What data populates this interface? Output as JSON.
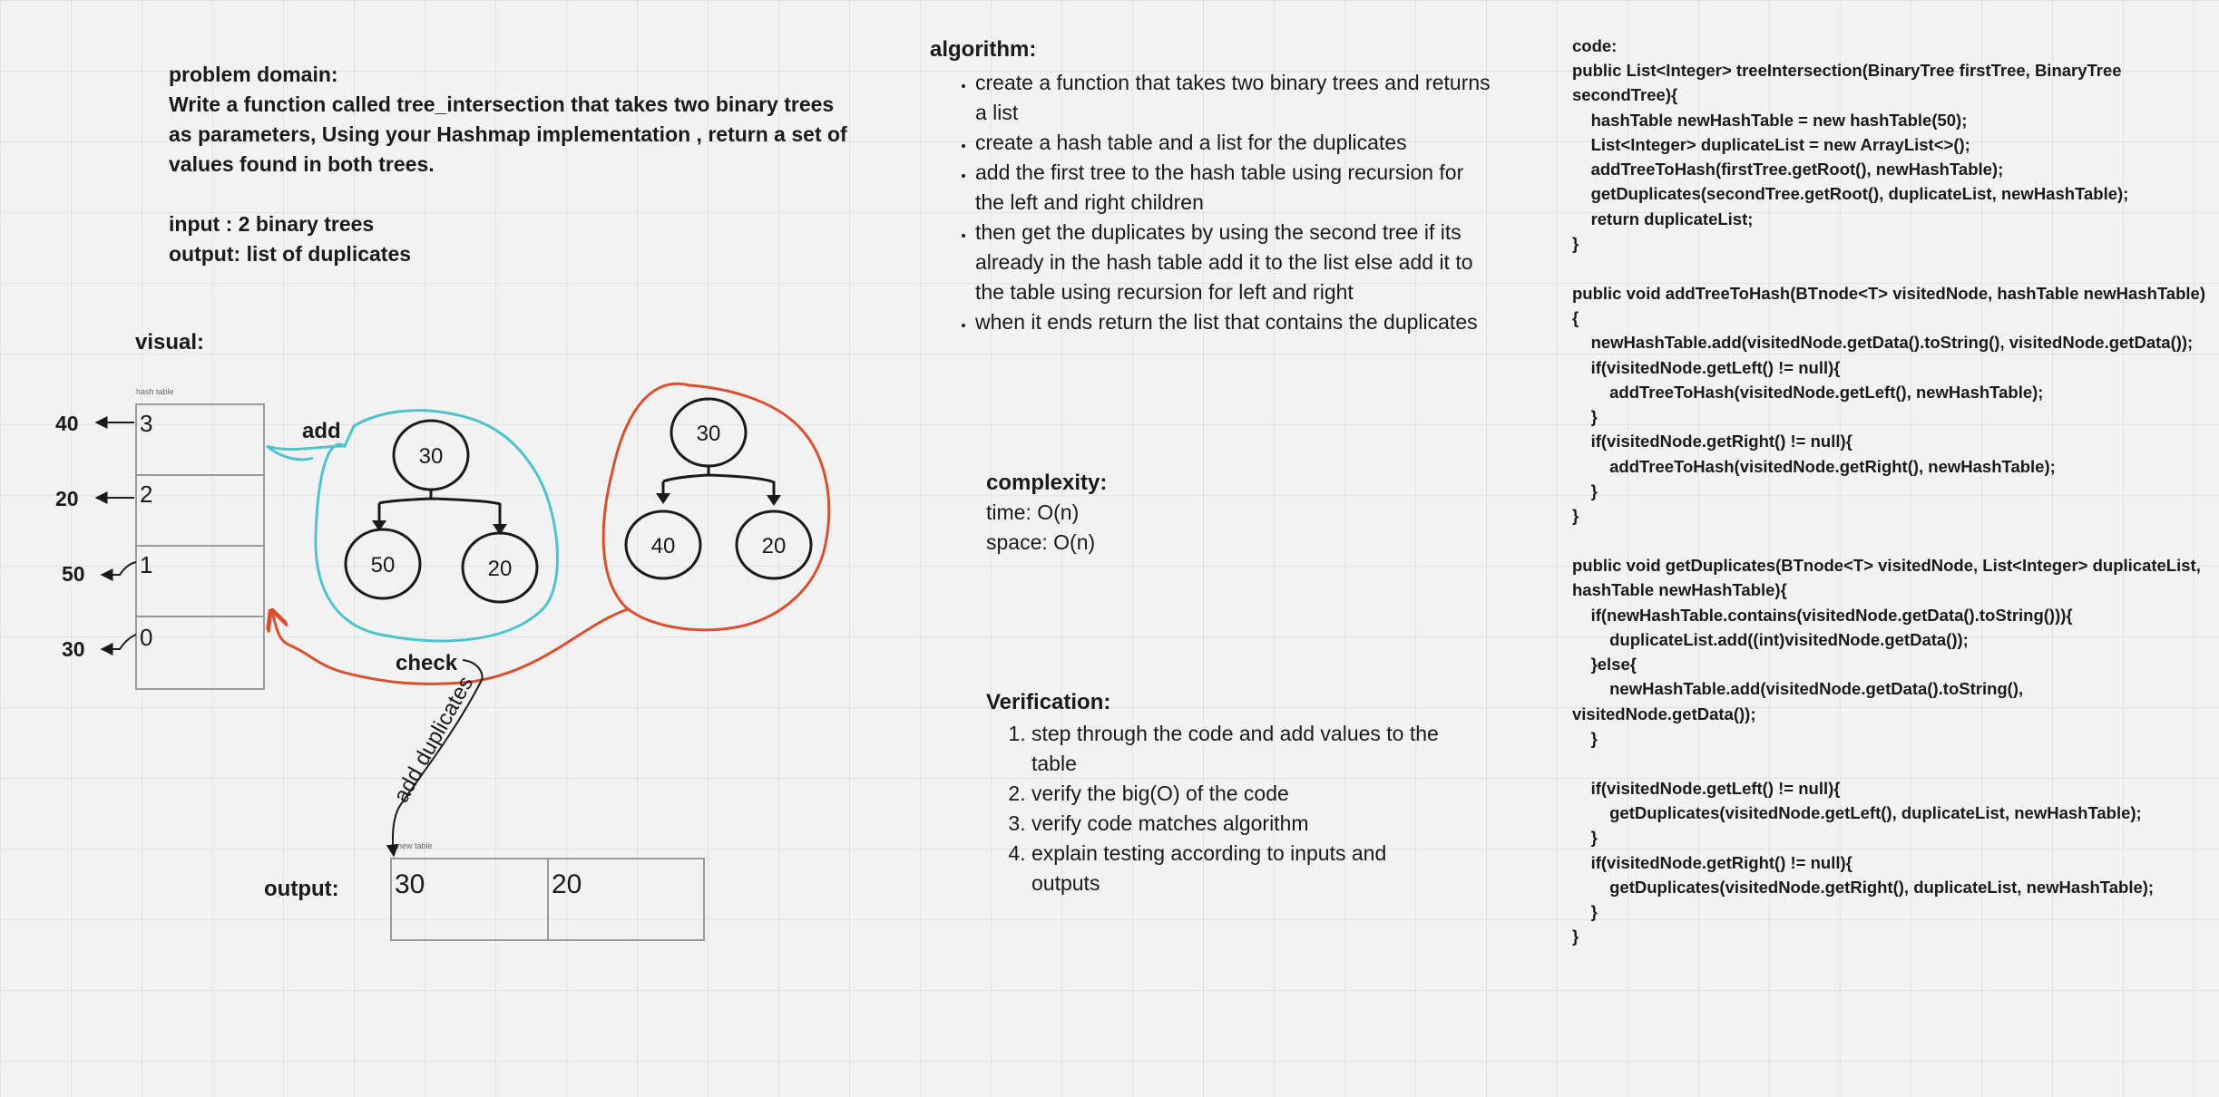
{
  "problem": {
    "heading": "problem domain:",
    "text": "Write a function called tree_intersection that takes two binary trees as parameters, Using your Hashmap implementation , return a set of values found in both trees.",
    "input": "input : 2 binary trees",
    "output": "output: list of duplicates"
  },
  "visual": {
    "label": "visual:",
    "hash_table_caption": "hash table",
    "hash_table_indices": [
      "3",
      "2",
      "1",
      "0"
    ],
    "side_values": [
      "40",
      "20",
      "50",
      "30"
    ],
    "add_label": "add",
    "check_label": "check",
    "add_duplicates_label": "add duplicates",
    "tree1": {
      "root": "30",
      "left": "50",
      "right": "20",
      "color": "#4fc3cc"
    },
    "tree2": {
      "root": "30",
      "left": "40",
      "right": "20",
      "color": "#d9502f"
    }
  },
  "output": {
    "label": "output:",
    "caption": "new table",
    "values": [
      "30",
      "20"
    ]
  },
  "algorithm": {
    "heading": "algorithm:",
    "steps": [
      "create a function that takes two binary trees and returns a list",
      "create a hash table and a list for the duplicates",
      "add the first tree to the hash table using recursion for the left and right children",
      "then get the duplicates by using the second tree if its already in the hash table add it to the list else add it to the table using recursion for left and right",
      "when it ends return the list that contains the duplicates"
    ]
  },
  "complexity": {
    "heading": "complexity:",
    "time": "time: O(n)",
    "space": "space: O(n)"
  },
  "verification": {
    "heading": "Verification:",
    "steps": [
      "step through the code and add values to the table",
      "verify the big(O) of the code",
      "verify code matches algorithm",
      "explain testing according to inputs and outputs"
    ]
  },
  "code": {
    "heading": "code:",
    "body": "public List<Integer> treeIntersection(BinaryTree firstTree, BinaryTree secondTree){\n    hashTable newHashTable = new hashTable(50);\n    List<Integer> duplicateList = new ArrayList<>();\n    addTreeToHash(firstTree.getRoot(), newHashTable);\n    getDuplicates(secondTree.getRoot(), duplicateList, newHashTable);\n    return duplicateList;\n}\n\npublic void addTreeToHash(BTnode<T> visitedNode, hashTable newHashTable){\n    newHashTable.add(visitedNode.getData().toString(), visitedNode.getData());\n    if(visitedNode.getLeft() != null){\n        addTreeToHash(visitedNode.getLeft(), newHashTable);\n    }\n    if(visitedNode.getRight() != null){\n        addTreeToHash(visitedNode.getRight(), newHashTable);\n    }\n}\n\npublic void getDuplicates(BTnode<T> visitedNode, List<Integer> duplicateList, hashTable newHashTable){\n    if(newHashTable.contains(visitedNode.getData().toString())){\n        duplicateList.add((int)visitedNode.getData());\n    }else{\n        newHashTable.add(visitedNode.getData().toString(), visitedNode.getData());\n    }\n\n    if(visitedNode.getLeft() != null){\n        getDuplicates(visitedNode.getLeft(), duplicateList, newHashTable);\n    }\n    if(visitedNode.getRight() != null){\n        getDuplicates(visitedNode.getRight(), duplicateList, newHashTable);\n    }\n}"
  }
}
